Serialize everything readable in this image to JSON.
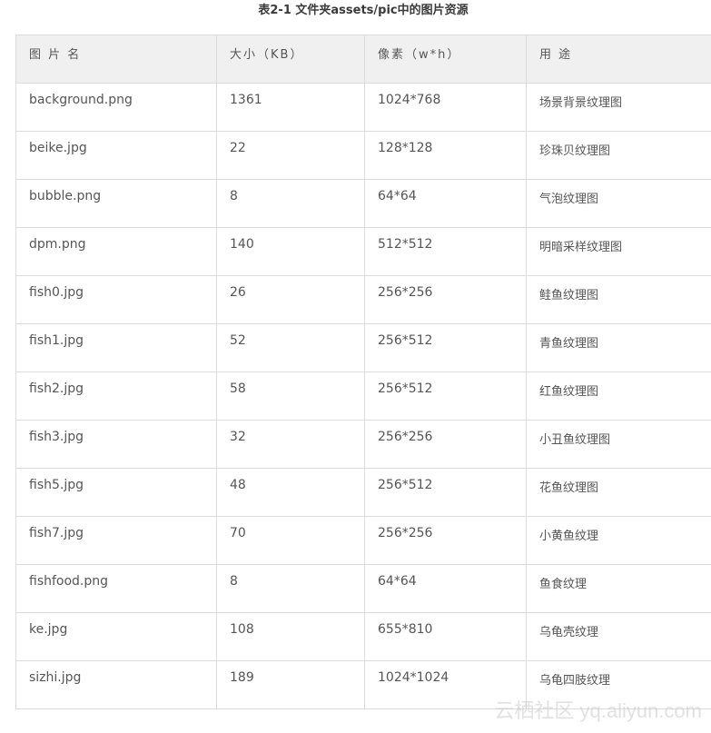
{
  "caption": "表2-1 文件夹assets/pic中的图片资源",
  "table": {
    "headers": [
      "图 片 名",
      "大小（KB）",
      "像素（w*h）",
      "用 途"
    ],
    "rows": [
      {
        "name": "background.png",
        "size": "1361",
        "pixels": "1024*768",
        "use": "场景背景纹理图"
      },
      {
        "name": "beike.jpg",
        "size": "22",
        "pixels": "128*128",
        "use": "珍珠贝纹理图"
      },
      {
        "name": "bubble.png",
        "size": "8",
        "pixels": "64*64",
        "use": "气泡纹理图"
      },
      {
        "name": "dpm.png",
        "size": "140",
        "pixels": "512*512",
        "use": "明暗采样纹理图"
      },
      {
        "name": "fish0.jpg",
        "size": "26",
        "pixels": "256*256",
        "use": "鲑鱼纹理图"
      },
      {
        "name": "fish1.jpg",
        "size": "52",
        "pixels": "256*512",
        "use": "青鱼纹理图"
      },
      {
        "name": "fish2.jpg",
        "size": "58",
        "pixels": "256*512",
        "use": "红鱼纹理图"
      },
      {
        "name": "fish3.jpg",
        "size": "32",
        "pixels": "256*256",
        "use": "小丑鱼纹理图"
      },
      {
        "name": "fish5.jpg",
        "size": "48",
        "pixels": "256*512",
        "use": "花鱼纹理图"
      },
      {
        "name": "fish7.jpg",
        "size": "70",
        "pixels": "256*256",
        "use": "小黄鱼纹理"
      },
      {
        "name": "fishfood.png",
        "size": "8",
        "pixels": "64*64",
        "use": "鱼食纹理"
      },
      {
        "name": "ke.jpg",
        "size": "108",
        "pixels": "655*810",
        "use": "乌龟壳纹理"
      },
      {
        "name": "sizhi.jpg",
        "size": "189",
        "pixels": "1024*1024",
        "use": "乌龟四肢纹理"
      }
    ]
  },
  "watermark": "云栖社区 yq.aliyun.com"
}
